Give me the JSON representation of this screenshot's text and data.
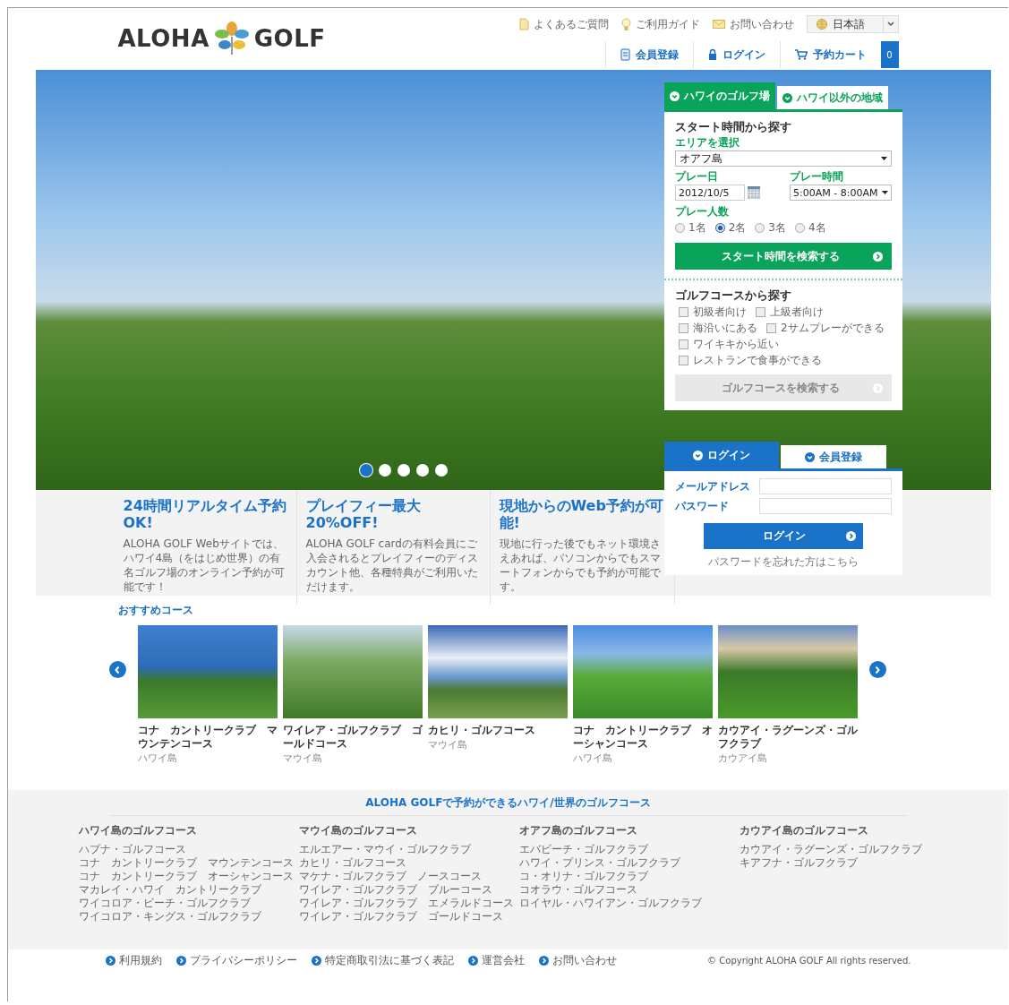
{
  "header": {
    "logo_left": "ALOHA",
    "logo_right": "GOLF",
    "utility_links": [
      {
        "kind": "faq",
        "label": "よくあるご質問"
      },
      {
        "kind": "guide",
        "label": "ご利用ガイド"
      },
      {
        "kind": "contact",
        "label": "お問い合わせ"
      }
    ],
    "language": "日本語",
    "nav": [
      {
        "kind": "register",
        "label": "会員登録"
      },
      {
        "kind": "login",
        "label": "ログイン"
      },
      {
        "kind": "cart",
        "label": "予約カート"
      }
    ],
    "cart_count": "0"
  },
  "hero": {
    "slides": [
      {
        "selected": true
      },
      {
        "selected": false
      },
      {
        "selected": false
      },
      {
        "selected": false
      },
      {
        "selected": false
      }
    ]
  },
  "search_panel": {
    "tabs": [
      {
        "label": "ハワイのゴルフ場",
        "selected": true
      },
      {
        "label": "ハワイ以外の地域",
        "selected": false
      }
    ],
    "title": "スタート時間から探す",
    "area_label": "エリアを選択",
    "area_value": "オアフ島",
    "date_label": "プレー日",
    "date_value": "2012/10/5",
    "time_label": "プレー時間",
    "time_value": "5:00AM - 8:00AM",
    "players_label": "プレー人数",
    "players": [
      {
        "label": "1名",
        "selected": false
      },
      {
        "label": "2名",
        "selected": true
      },
      {
        "label": "3名",
        "selected": false
      },
      {
        "label": "4名",
        "selected": false
      }
    ],
    "search_button": "スタート時間を検索する",
    "course_title": "ゴルフコースから探す",
    "feature_rows": [
      [
        {
          "label": "初級者向け",
          "checked": false
        },
        {
          "label": "上級者向け",
          "checked": false
        }
      ],
      [
        {
          "label": "海沿いにある",
          "checked": false
        },
        {
          "label": "2サムプレーができる",
          "checked": false
        }
      ],
      [
        {
          "label": "ワイキキから近い",
          "checked": false
        }
      ],
      [
        {
          "label": "レストランで食事ができる",
          "checked": false
        }
      ]
    ],
    "course_button": {
      "label": "ゴルフコースを検索する",
      "disabled": true
    }
  },
  "login_panel": {
    "tabs": [
      {
        "label": "ログイン",
        "selected": true
      },
      {
        "label": "会員登録",
        "selected": false
      }
    ],
    "email_label": "メールアドレス",
    "password_label": "パスワード",
    "button": "ログイン",
    "forgot_link": "パスワードを忘れた方はこちら"
  },
  "features": [
    {
      "title": "24時間リアルタイム予約OK!",
      "text": "ALOHA GOLF Webサイトでは、ハワイ4島（をはじめ世界）の有名ゴルフ場のオンライン予約が可能です！"
    },
    {
      "title": "プレイフィー最大20%OFF!",
      "text": "ALOHA GOLF cardの有料会員にご入会されるとプレイフィーのディスカウント他、各種特典がご利用いただけます。"
    },
    {
      "title": "現地からのWeb予約が可能!",
      "text": "現地に行った後でもネット環境さえあれば、パソコンからでもスマートフォンからでも予約が可能です。"
    }
  ],
  "recommended": {
    "title": "おすすめコース",
    "courses": [
      {
        "name": "コナ　カントリークラブ　マウンテンコース",
        "island": "ハワイ島"
      },
      {
        "name": "ワイレア・ゴルフクラブ　ゴールドコース",
        "island": "マウイ島"
      },
      {
        "name": "カヒリ・ゴルフコース",
        "island": "マウイ島"
      },
      {
        "name": "コナ　カントリークラブ　オーシャンコース",
        "island": "ハワイ島"
      },
      {
        "name": "カウアイ・ラグーンズ・ゴルフクラブ",
        "island": "カウアイ島"
      }
    ]
  },
  "footer": {
    "title": "ALOHA GOLFで予約ができるハワイ/世界のゴルフコース",
    "columns": [
      {
        "heading": "ハワイ島のゴルフコース",
        "links": [
          "ハプナ・ゴルフコース",
          "コナ　カントリークラブ　マウンテンコース",
          "コナ　カントリークラブ　オーシャンコース",
          "マカレイ・ハワイ　カントリークラブ",
          "ワイコロア・ビーチ・ゴルフクラブ",
          "ワイコロア・キングス・ゴルフクラブ"
        ]
      },
      {
        "heading": "マウイ島のゴルフコース",
        "links": [
          "エルエアー・マウイ・ゴルフクラブ",
          "カヒリ・ゴルフコース",
          "マケナ・ゴルフクラブ　ノースコース",
          "ワイレア・ゴルフクラブ　ブルーコース",
          "ワイレア・ゴルフクラブ　エメラルドコース",
          "ワイレア・ゴルフクラブ　ゴールドコース"
        ]
      },
      {
        "heading": "オアフ島のゴルフコース",
        "links": [
          "エバビーチ・ゴルフクラブ",
          "ハワイ・プリンス・ゴルフクラブ",
          "コ・オリナ・ゴルフクラブ",
          "コオラウ・ゴルフコース",
          "ロイヤル・ハワイアン・ゴルフクラブ"
        ]
      },
      {
        "heading": "カウアイ島のゴルフコース",
        "links": [
          "カウアイ・ラグーンズ・ゴルフクラブ",
          "キアフナ・ゴルフクラブ"
        ]
      }
    ],
    "bottom_links": [
      "利用規約",
      "プライバシーポリシー",
      "特定商取引法に基づく表記",
      "運営会社",
      "お問い合わせ"
    ],
    "copyright": "© Copyright ALOHA GOLF All rights reserved."
  }
}
